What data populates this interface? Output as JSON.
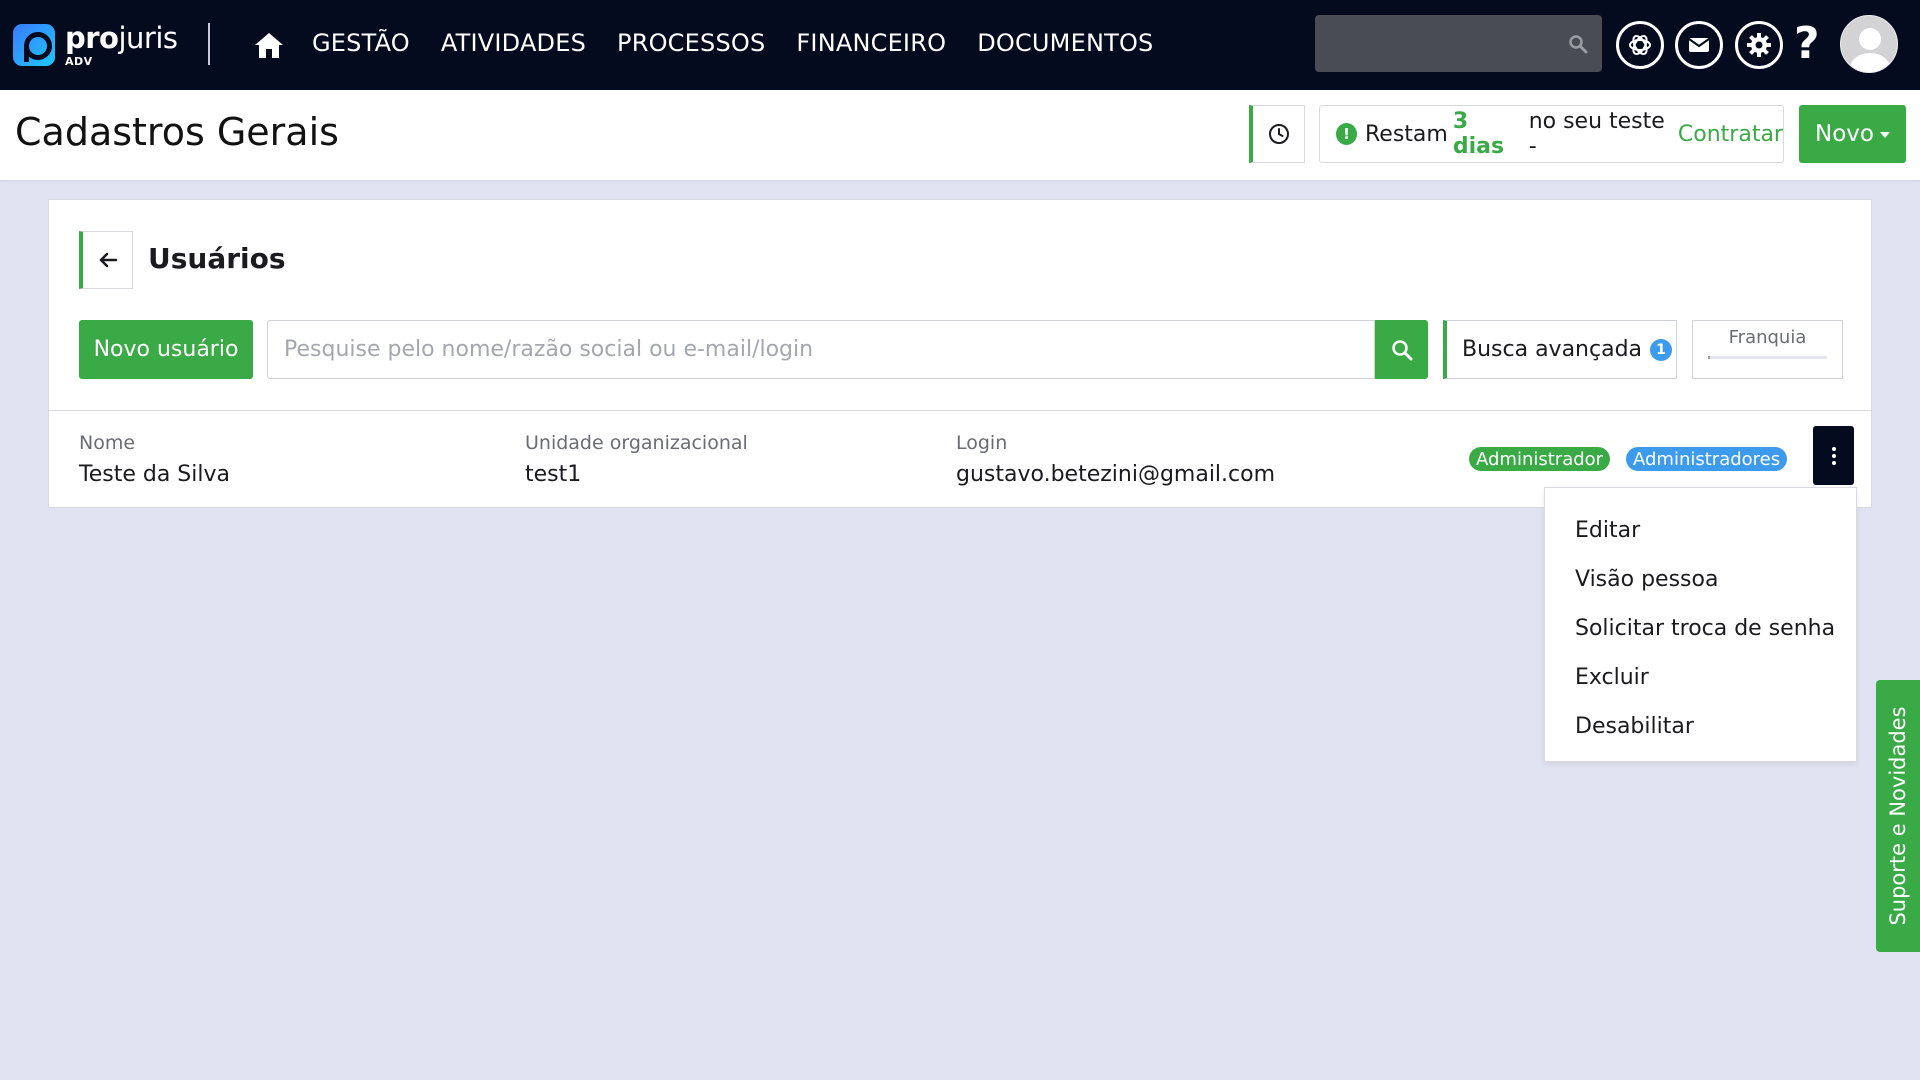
{
  "brand": {
    "name_bold": "pro",
    "name_rest": "juris",
    "sub": "ADV"
  },
  "nav": {
    "items": [
      "GESTÃO",
      "ATIVIDADES",
      "PROCESSOS",
      "FINANCEIRO",
      "DOCUMENTOS"
    ]
  },
  "search": {
    "value": "",
    "placeholder": ""
  },
  "header_icons": [
    "ai-assistant-icon",
    "mail-icon",
    "settings-icon",
    "help-icon",
    "avatar"
  ],
  "subheader": {
    "title": "Cadastros Gerais",
    "trial": {
      "prefix": "Restam",
      "days": "3 dias",
      "suffix": "no seu teste -",
      "link": "Contratar"
    },
    "new_button": "Novo"
  },
  "section": {
    "title": "Usuários",
    "new_user_button": "Novo usuário",
    "search_placeholder": "Pesquise pelo nome/razão social ou e-mail/login",
    "advanced_search": {
      "label": "Busca avançada",
      "badge": "1"
    },
    "franchise_label": "Franquia"
  },
  "user_row": {
    "name_label": "Nome",
    "name": "Teste da Silva",
    "unit_label": "Unidade organizacional",
    "unit": "test1",
    "login_label": "Login",
    "login": "gustavo.betezini@gmail.com",
    "tags": [
      "Administrador",
      "Administradores"
    ]
  },
  "row_menu": [
    "Editar",
    "Visão pessoa",
    "Solicitar troca de senha",
    "Excluir",
    "Desabilitar"
  ],
  "support_tab": "Suporte e Novidades",
  "colors": {
    "navbar": "#050b1f",
    "accent_green": "#3aaa46",
    "badge_blue": "#3c9bed",
    "background": "#e0e3f1"
  }
}
